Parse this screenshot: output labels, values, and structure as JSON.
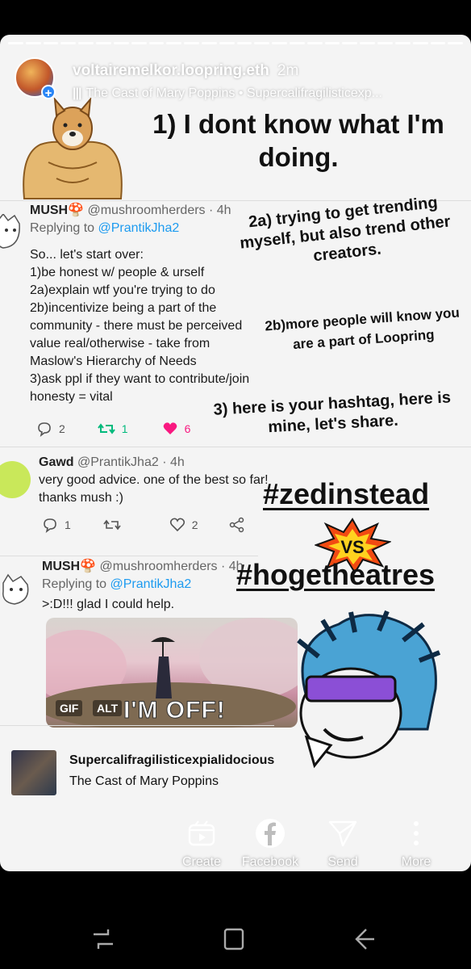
{
  "header": {
    "username": "voltairemelkor.loopring.eth",
    "time": "2m",
    "music_icon": "bars-icon",
    "music": "The Cast of Mary Poppins • Supercalifragilisticexp..."
  },
  "title": {
    "line1": "1) I dont know what I'm",
    "line2": "doing."
  },
  "tweet1": {
    "name": "MUSH🍄",
    "handle": "@mushroomherders · 4h",
    "replying_prefix": "Replying to ",
    "replying_to": "@PrantikJha2",
    "lines": [
      "So... let's start over:",
      "1)be honest w/ people & urself",
      "2a)explain wtf you're trying to do",
      "2b)incentivize being a part of the",
      "community - there must be perceived",
      "value real/otherwise - take from",
      "Maslow's Hierarchy of Needs",
      "3)ask ppl if they want to contribute/join",
      "honesty = vital"
    ],
    "replies": "2",
    "retweets": "1",
    "likes": "6"
  },
  "annotations": {
    "a2a": "2a) trying to get trending myself, but also trend other creators.",
    "a2b": "2b)more people will know you are a part of Loopring",
    "a3": "3) here is your hashtag, here is mine, let's share."
  },
  "tweet2": {
    "name": "Gawd",
    "handle": "@PrantikJha2 · 4h",
    "lines": [
      "very good advice. one of the best so far!",
      "thanks mush :)"
    ],
    "replies": "1",
    "likes": "2"
  },
  "tags": {
    "tag1": "#zedinstead",
    "vs": "VS",
    "tag2": "#hogetheatres"
  },
  "tweet3": {
    "name": "MUSH🍄",
    "handle": "@mushroomherders · 4h",
    "replying_prefix": "Replying to ",
    "replying_to": "@PrantikJha2",
    "text": ">:D!!! glad I could help.",
    "gif_badge": "GIF",
    "alt_badge": "ALT",
    "gif_text": "I'M OFF!"
  },
  "song": {
    "title": "Supercalifragilisticexpialidocious",
    "artist": "The Cast of Mary Poppins"
  },
  "share": {
    "create": "Create",
    "facebook": "Facebook",
    "send": "Send",
    "more": "More"
  },
  "colors": {
    "accent_blue": "#1d9bf0",
    "retweet_green": "#00ba7c",
    "like_pink": "#f91880"
  }
}
